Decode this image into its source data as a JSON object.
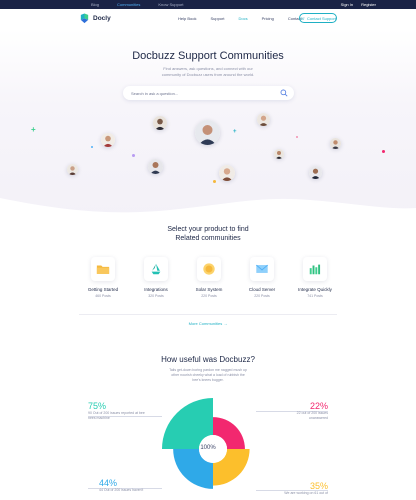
{
  "topbar": {
    "links": [
      "Blog",
      "Communities",
      "Know Support"
    ],
    "active_index": 1,
    "right": [
      "Sign In",
      "Register"
    ]
  },
  "navbar": {
    "logo_text": "Docly",
    "items": [
      "Help Book",
      "Support",
      "Docs",
      "Pricing",
      "Contact"
    ],
    "active_index": 2,
    "cta_label": "Contact Support"
  },
  "hero": {
    "title": "Docbuzz Support Communities",
    "subtitle": "Find answers, ask questions, and connect with our community of Docbuzz users from around the world.",
    "search_placeholder": "Search in ask a question..."
  },
  "products_section": {
    "title_line1": "Select your product to find",
    "title_line2": "Related communities",
    "products": [
      {
        "name": "Getting Started",
        "count": "460 Posts",
        "icon": "folder-icon",
        "color": "#f5b83d"
      },
      {
        "name": "Integrations",
        "count": "320 Posts",
        "icon": "recycle-icon",
        "color": "#22c1b4"
      },
      {
        "name": "Solar System",
        "count": "220 Posts",
        "icon": "sun-icon",
        "color": "#f5b83d"
      },
      {
        "name": "Cloud Server",
        "count": "220 Posts",
        "icon": "mail-icon",
        "color": "#4fb0f7"
      },
      {
        "name": "Integrate Quickly",
        "count": "741 Posts",
        "icon": "bar-chart-icon",
        "color": "#3ccf8e"
      }
    ],
    "more_link": "More Communities →"
  },
  "useful_section": {
    "title": "How useful was Docbuzz?",
    "subtitle": "Tails get-down boring pardon me nagged mush up other nourish cheeky what a load of rubbish the bee's knees bugger.",
    "center_label": "100%"
  },
  "chart_data": {
    "type": "pie",
    "title": "How useful was Docbuzz?",
    "slices": [
      {
        "label": "75%",
        "value": 75,
        "color": "#27cdb2",
        "note": "90 Out of 200 issues reported at bee nees machine"
      },
      {
        "label": "22%",
        "value": 22,
        "color": "#f2286f",
        "note": "22 out of 200 issues unanswered"
      },
      {
        "label": "35%",
        "value": 35,
        "color": "#fcbf2c",
        "note": "We are working on 61 out of"
      },
      {
        "label": "44%",
        "value": 44,
        "color": "#2fa9e8",
        "note": "44 Out of 200 issues haven't"
      }
    ]
  },
  "colors": {
    "accent": "#1fb0c4",
    "dark": "#1a2346",
    "text": "#1d2746",
    "muted": "#8a8fa6"
  }
}
